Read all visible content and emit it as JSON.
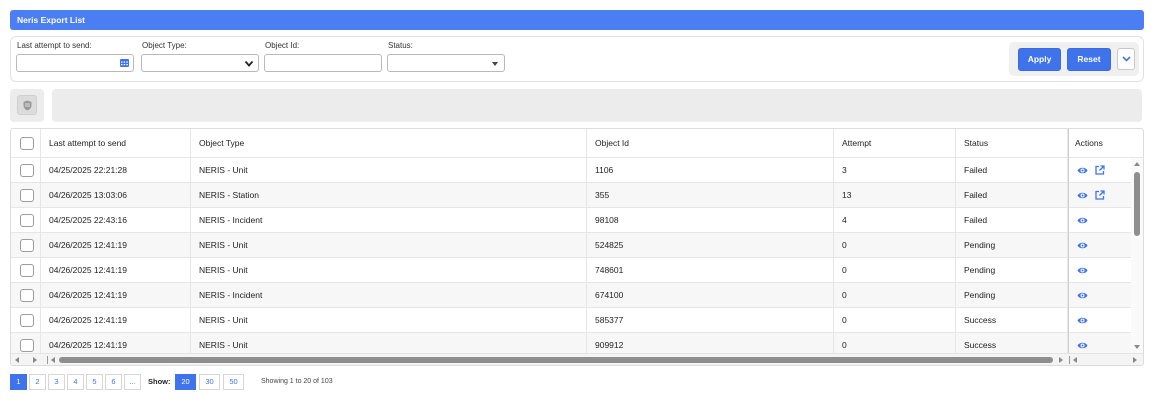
{
  "title": "Neris Export List",
  "filters": {
    "last_attempt_label": "Last attempt to send:",
    "object_type_label": "Object Type:",
    "object_id_label": "Object Id:",
    "status_label": "Status:",
    "last_attempt_value": "",
    "object_type_value": "",
    "object_id_value": "",
    "status_value": ""
  },
  "buttons": {
    "apply": "Apply",
    "reset": "Reset"
  },
  "table": {
    "columns": [
      "Last attempt to send",
      "Object Type",
      "Object Id",
      "Attempt",
      "Status",
      "Actions"
    ],
    "rows": [
      {
        "last_attempt": "04/25/2025 22:21:28",
        "object_type": "NERIS - Unit",
        "object_id": "1106",
        "attempt": "3",
        "status": "Failed",
        "actions": [
          "eye-icon",
          "export-icon"
        ]
      },
      {
        "last_attempt": "04/26/2025 13:03:06",
        "object_type": "NERIS - Station",
        "object_id": "355",
        "attempt": "13",
        "status": "Failed",
        "actions": [
          "eye-icon",
          "export-icon"
        ]
      },
      {
        "last_attempt": "04/25/2025 22:43:16",
        "object_type": "NERIS - Incident",
        "object_id": "98108",
        "attempt": "4",
        "status": "Failed",
        "actions": [
          "eye-icon"
        ]
      },
      {
        "last_attempt": "04/26/2025 12:41:19",
        "object_type": "NERIS - Unit",
        "object_id": "524825",
        "attempt": "0",
        "status": "Pending",
        "actions": [
          "eye-icon"
        ]
      },
      {
        "last_attempt": "04/26/2025 12:41:19",
        "object_type": "NERIS - Unit",
        "object_id": "748601",
        "attempt": "0",
        "status": "Pending",
        "actions": [
          "eye-icon"
        ]
      },
      {
        "last_attempt": "04/26/2025 12:41:19",
        "object_type": "NERIS - Incident",
        "object_id": "674100",
        "attempt": "0",
        "status": "Pending",
        "actions": [
          "eye-icon"
        ]
      },
      {
        "last_attempt": "04/26/2025 12:41:19",
        "object_type": "NERIS - Unit",
        "object_id": "585377",
        "attempt": "0",
        "status": "Success",
        "actions": [
          "eye-icon"
        ]
      },
      {
        "last_attempt": "04/26/2025 12:41:19",
        "object_type": "NERIS - Unit",
        "object_id": "909912",
        "attempt": "0",
        "status": "Success",
        "actions": [
          "eye-icon"
        ]
      }
    ]
  },
  "pagination": {
    "pages": [
      "1",
      "2",
      "3",
      "4",
      "5",
      "6",
      "..."
    ],
    "current_page": "1",
    "show_label": "Show:",
    "page_sizes": [
      "20",
      "30",
      "50"
    ],
    "current_size": "20",
    "summary": "Showing 1 to 20 of 103"
  },
  "colors": {
    "accent": "#3f73ec",
    "title_bar": "#4a7ef2"
  }
}
